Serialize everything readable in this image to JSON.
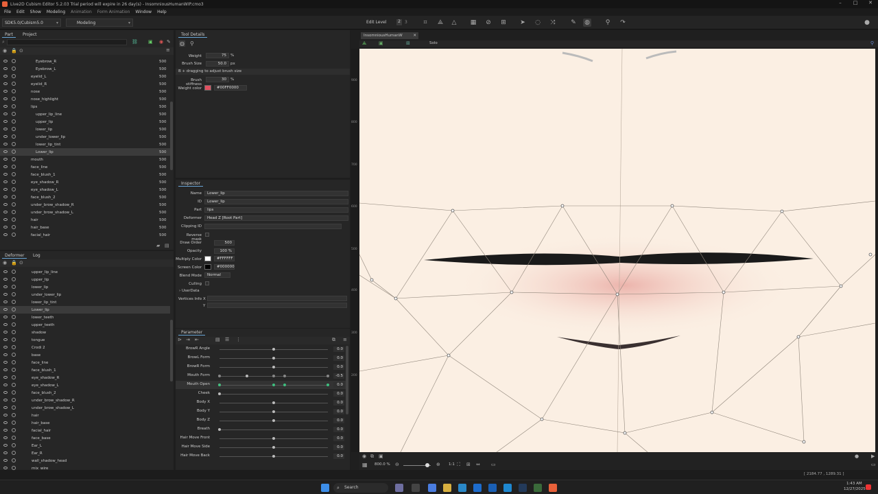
{
  "window": {
    "title": "Live2D Cubism Editor 5.2.03    Trial period will expire in 26 day(s)  - InsomniousHumanWIP.cmo3"
  },
  "menu": [
    "File",
    "Edit",
    "Show",
    "Modeling",
    "Animation",
    "Form Animation",
    "Window",
    "Help"
  ],
  "toolbar": {
    "sdk": "SDK5.0/Cubism5.0",
    "mode": "Modeling",
    "edit_level_label": "Edit Level",
    "edit_levels": [
      "1",
      "2",
      "3"
    ]
  },
  "part_panel": {
    "tabs": [
      "Part",
      "Project"
    ],
    "rows": [
      {
        "name": "Eyebrow_R",
        "count": "500"
      },
      {
        "name": "Eyebrow_L",
        "count": "500"
      },
      {
        "name": "eyelid_L",
        "count": "500"
      },
      {
        "name": "eyelid_R",
        "count": "500"
      },
      {
        "name": "nose",
        "count": "500"
      },
      {
        "name": "nose_highlight",
        "count": "500"
      },
      {
        "name": "lips",
        "count": "500"
      },
      {
        "name": "upper_lip_line",
        "count": "500"
      },
      {
        "name": "upper_lip",
        "count": "500"
      },
      {
        "name": "lower_lip",
        "count": "500"
      },
      {
        "name": "under_lower_lip",
        "count": "500"
      },
      {
        "name": "lower_lip_tint",
        "count": "500"
      },
      {
        "name": "Lower_lip",
        "count": "500"
      },
      {
        "name": "mouth",
        "count": "500"
      },
      {
        "name": "face_line",
        "count": "500"
      },
      {
        "name": "face_blush_1",
        "count": "500"
      },
      {
        "name": "eye_shadow_R",
        "count": "500"
      },
      {
        "name": "eye_shadow_L",
        "count": "500"
      },
      {
        "name": "face_blush_2",
        "count": "500"
      },
      {
        "name": "under_brow_shadow_R",
        "count": "500"
      },
      {
        "name": "under_brow_shadow_L",
        "count": "500"
      },
      {
        "name": "hair",
        "count": "500"
      },
      {
        "name": "hair_base",
        "count": "500"
      },
      {
        "name": "facial_hair",
        "count": "500"
      }
    ]
  },
  "deformer_panel": {
    "tabs": [
      "Deformer",
      "Log"
    ],
    "rows": [
      "upper_lip_line",
      "upper_lip",
      "lower_lip",
      "under_lower_lip",
      "lower_lip_tint",
      "Lower_lip",
      "lower_teeth",
      "upper_teeth",
      "shadow",
      "tongue",
      "Crodi 2",
      "base",
      "face_line",
      "face_blush_1",
      "eye_shadow_R",
      "eye_shadow_L",
      "face_blush_2",
      "under_brow_shadow_R",
      "under_brow_shadow_L",
      "hair",
      "hair_base",
      "facial_hair",
      "face_base",
      "Ear_L",
      "Ear_R",
      "wall_shadow_head",
      "mix_wire"
    ]
  },
  "tool_details": {
    "title": "Tool Details",
    "weight_label": "Weight",
    "weight": "75",
    "weight_unit": "%",
    "brush_size_label": "Brush Size",
    "brush_size": "50.0",
    "brush_unit": "px",
    "hint": "B + dragging to adjust brush size",
    "stiffness_label": "Brush stiffness",
    "stiffness": "30",
    "stiffness_unit": "%",
    "color_label": "Weight color",
    "color_value": "#00FF0000",
    "color_swatch": "#e05060"
  },
  "inspector": {
    "title": "Inspector",
    "fields": [
      {
        "label": "Name",
        "value": "Lower_lip"
      },
      {
        "label": "ID",
        "value": "Lower_lip"
      },
      {
        "label": "Part",
        "value": "lips"
      },
      {
        "label": "Deformer",
        "value": "Head Z  [Root Part]"
      },
      {
        "label": "Clipping ID",
        "value": ""
      }
    ],
    "reverse_mask_label": "Reverse mask",
    "draw_order_label": "Draw Order",
    "draw_order": "500",
    "opacity_label": "Opacity",
    "opacity": "100 %",
    "multiply_label": "Multiply Color",
    "multiply": "#FFFFFF",
    "screen_label": "Screen Color",
    "screen": "#000000",
    "blend_label": "Blend Mode",
    "blend": "Normal",
    "culling_label": "Culling",
    "userdata_label": "UserData",
    "vertices_label": "Vertices Info",
    "vx": "X",
    "vy": "Y"
  },
  "parameter": {
    "title": "Parameter",
    "rows": [
      {
        "name": "BrowR Angle",
        "value": "0.0",
        "level": 0.5
      },
      {
        "name": "BrowL Form",
        "value": "0.0",
        "level": 0.5
      },
      {
        "name": "BrowR Form",
        "value": "0.0",
        "level": 0.5
      },
      {
        "name": "Mouth Form",
        "value": "-0.5",
        "level": 0.25
      },
      {
        "name": "Mouth Open",
        "value": "0.0",
        "level": 0.0
      },
      {
        "name": "Cheek",
        "value": "0.0",
        "level": 0.0
      },
      {
        "name": "Body X",
        "value": "0.0",
        "level": 0.5
      },
      {
        "name": "Body Y",
        "value": "0.0",
        "level": 0.5
      },
      {
        "name": "Body Z",
        "value": "0.0",
        "level": 0.5
      },
      {
        "name": "Breath",
        "value": "0.0",
        "level": 0.0
      },
      {
        "name": "Hair Move Front",
        "value": "0.0",
        "level": 0.5
      },
      {
        "name": "Hair Move Side",
        "value": "0.0",
        "level": 0.5
      },
      {
        "name": "Hair Move Back",
        "value": "0.0",
        "level": 0.5
      }
    ]
  },
  "viewport": {
    "tab": "InsomniousHumanW",
    "solo": "Solo",
    "zoom": "800.0 %",
    "ratio": "1:1",
    "ruler": [
      "900",
      "800",
      "700",
      "600",
      "500",
      "400",
      "300",
      "200"
    ]
  },
  "status": {
    "coords": "[ 2184.77 , 1289.31 ]"
  },
  "taskbar": {
    "search": "Search",
    "time": "1:43 AM",
    "date": "12/27/2025"
  }
}
